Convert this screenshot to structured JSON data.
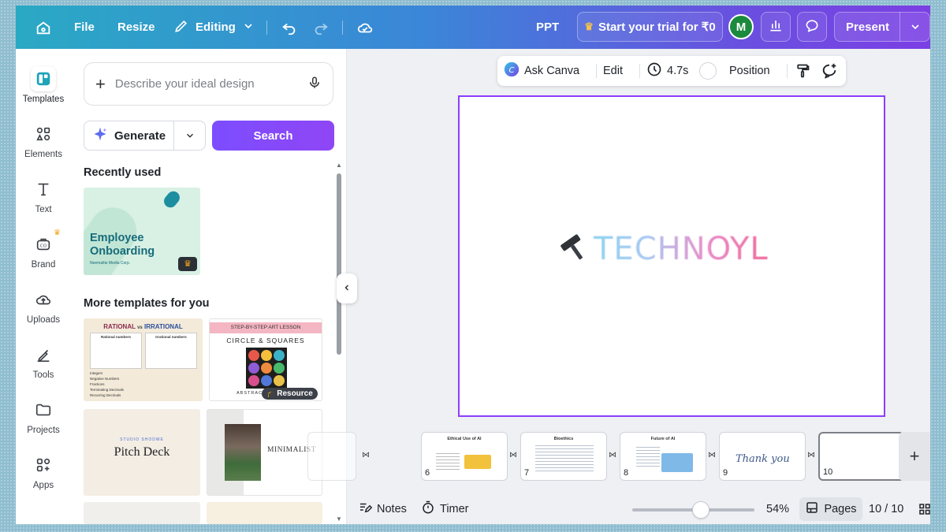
{
  "topbar": {
    "file": "File",
    "resize": "Resize",
    "editing": "Editing",
    "doc_type": "PPT",
    "trial": "Start your trial for ₹0",
    "avatar_initial": "M",
    "present": "Present"
  },
  "rail": {
    "items": [
      {
        "label": "Templates",
        "icon": "templates-icon"
      },
      {
        "label": "Elements",
        "icon": "elements-icon"
      },
      {
        "label": "Text",
        "icon": "text-icon"
      },
      {
        "label": "Brand",
        "icon": "brand-icon"
      },
      {
        "label": "Uploads",
        "icon": "uploads-icon"
      },
      {
        "label": "Tools",
        "icon": "tools-icon"
      },
      {
        "label": "Projects",
        "icon": "projects-icon"
      },
      {
        "label": "Apps",
        "icon": "apps-icon"
      }
    ]
  },
  "panel": {
    "describe_placeholder": "Describe your ideal design",
    "generate": "Generate",
    "search": "Search",
    "recently_used": "Recently used",
    "more_templates": "More templates for you",
    "recent_template": {
      "title_line1": "Employee",
      "title_line2": "Onboarding",
      "subtitle": "Neemaltie Media Corp."
    },
    "templates": {
      "rational": {
        "title_a": "RATIONAL",
        "vs": "vs",
        "title_b": "IRRATIONAL",
        "left_head": "Rational numbers",
        "right_head": "Irrational numbers",
        "rows": [
          "Integers",
          "Negative Numbers",
          "Fractions",
          "Terminating Decimals",
          "Recurring Decimals"
        ]
      },
      "art": {
        "header": "STEP-BY-STEP ART LESSON",
        "title": "CIRCLE & SQUARES",
        "footer": "ABSTRAC",
        "badge": "Resource"
      },
      "pitch": {
        "small": "STUDIO SHODWE",
        "title": "Pitch Deck"
      },
      "minimal": {
        "title": "MINIMALIST"
      }
    }
  },
  "context_toolbar": {
    "ask_canva": "Ask Canva",
    "edit": "Edit",
    "duration": "4.7s",
    "position": "Position"
  },
  "slide": {
    "logo_text": "TECHNOYL"
  },
  "pages": [
    {
      "num": "6",
      "title": "Ethical Use of AI"
    },
    {
      "num": "7",
      "title": "Bioethics"
    },
    {
      "num": "8",
      "title": "Future of AI"
    },
    {
      "num": "9",
      "title": "Thank you"
    },
    {
      "num": "10",
      "title": ""
    }
  ],
  "bottombar": {
    "notes": "Notes",
    "timer": "Timer",
    "zoom": "54%",
    "zoom_fraction": 0.54,
    "pages": "Pages",
    "page_count": "10 / 10"
  },
  "colors": {
    "accent": "#8b3dff",
    "avatar": "#1b8a3c",
    "crown": "#f3a81c"
  }
}
